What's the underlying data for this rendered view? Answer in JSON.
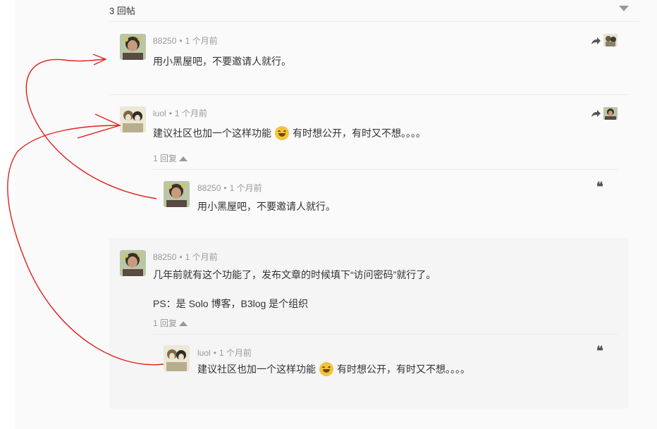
{
  "header": {
    "reply_count": "3 回帖"
  },
  "comments": [
    {
      "author": "88250",
      "time": "1 个月前",
      "text": "用小黑屋吧，不要邀请人就行。"
    },
    {
      "author": "luol",
      "time": "1 个月前",
      "text_before": "建议社区也加一个这样功能",
      "text_after": "有时想公开，有时又不想。。。。",
      "reply_toggle": "1 回复",
      "reply": {
        "author": "88250",
        "time": "1 个月前",
        "text": "用小黑屋吧，不要邀请人就行。"
      }
    },
    {
      "author": "88250",
      "time": "1 个月前",
      "text": "几年前就有这个功能了，发布文章的时候填下“访问密码”就行了。",
      "text2": "PS：是 Solo 博客，B3log 是个组织",
      "reply_toggle": "1 回复",
      "reply": {
        "author": "luol",
        "time": "1 个月前",
        "text_before": "建议社区也加一个这样功能",
        "text_after": "有时想公开，有时又不想。。。。"
      }
    }
  ],
  "separator": "•",
  "quote_glyph": "❝",
  "icons": {
    "share": "share-icon",
    "quote": "quote-icon",
    "collapse": "caret-down-icon",
    "emoji": "laughing-emoji-icon"
  },
  "colors": {
    "annotation": "#e0201e",
    "meta": "#999999",
    "text": "#333333"
  }
}
